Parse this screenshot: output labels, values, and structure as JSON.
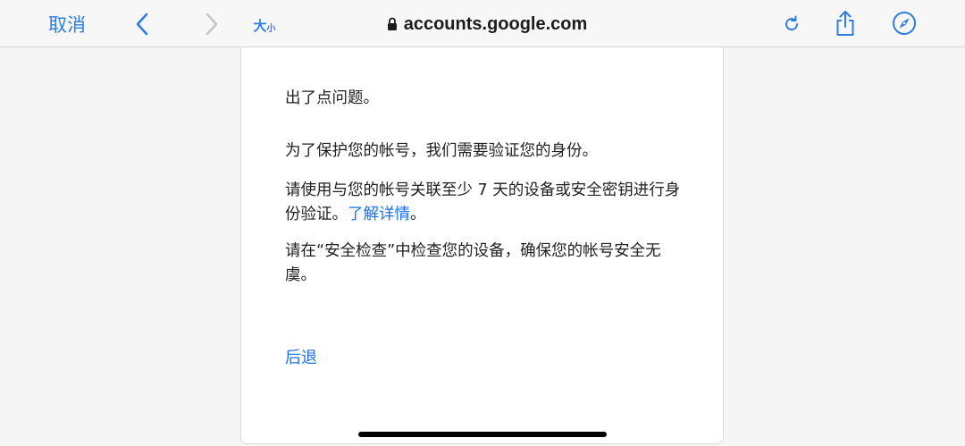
{
  "toolbar": {
    "cancel_label": "取消",
    "text_size_big": "大",
    "text_size_small": "小",
    "address": "accounts.google.com",
    "accent_color": "#2f7de1"
  },
  "page": {
    "heading": "出了点问题。",
    "para1": "为了保护您的帐号，我们需要验证您的身份。",
    "para2_text": "请使用与您的帐号关联至少 7 天的设备或安全密钥进行身份验证。",
    "para2_link": "了解详情",
    "para2_end": "。",
    "para3": "请在“安全检查”中检查您的设备，确保您的帐号安全无虞。",
    "back_label": "后退",
    "link_color": "#1a73e8"
  }
}
